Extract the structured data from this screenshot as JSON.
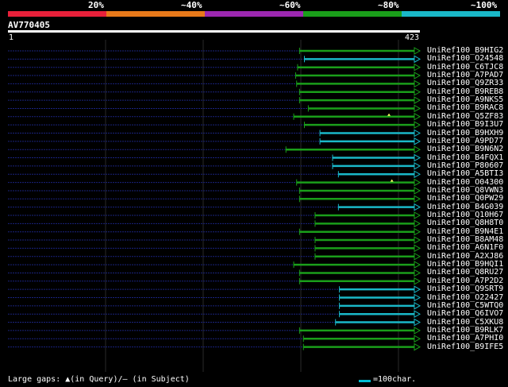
{
  "legend": {
    "segments": [
      {
        "label": "20%",
        "color": "#e8203a"
      },
      {
        "label": "~40%",
        "color": "#e8791a"
      },
      {
        "label": "~60%",
        "color": "#9c27b0"
      },
      {
        "label": "~80%",
        "color": "#1a9e1a"
      },
      {
        "label": "~100%",
        "color": "#1ab8c8"
      }
    ]
  },
  "query": {
    "name": "AV770405",
    "start": "1",
    "end": "423",
    "length": 423
  },
  "colors": {
    "green": "#1a9e1a",
    "cyan": "#1ab8c8",
    "dotted": "#1a237e",
    "grid": "#2a2a2a",
    "gap": "#ffff66"
  },
  "hits": [
    {
      "label": "UniRef100_B9HIG2",
      "start": 300,
      "color": "green",
      "gap": false
    },
    {
      "label": "UniRef100_O24548",
      "start": 305,
      "color": "cyan",
      "gap": false
    },
    {
      "label": "UniRef100_C6TJC8",
      "start": 298,
      "color": "green",
      "gap": false
    },
    {
      "label": "UniRef100_A7PAD7",
      "start": 296,
      "color": "green",
      "gap": false
    },
    {
      "label": "UniRef100_Q9ZR33",
      "start": 297,
      "color": "green",
      "gap": false
    },
    {
      "label": "UniRef100_B9REB8",
      "start": 300,
      "color": "green",
      "gap": false
    },
    {
      "label": "UniRef100_A9NKS5",
      "start": 300,
      "color": "green",
      "gap": false
    },
    {
      "label": "UniRef100_B9RAC8",
      "start": 309,
      "color": "green",
      "gap": false
    },
    {
      "label": "UniRef100_Q5ZF83",
      "start": 294,
      "color": "green",
      "gap": true,
      "gap_at": 392
    },
    {
      "label": "UniRef100_B9I3U7",
      "start": 305,
      "color": "green",
      "gap": false
    },
    {
      "label": "UniRef100_B9HXH9",
      "start": 321,
      "color": "cyan",
      "gap": false
    },
    {
      "label": "UniRef100_A9PD77",
      "start": 321,
      "color": "cyan",
      "gap": false
    },
    {
      "label": "UniRef100_B9N6N2",
      "start": 286,
      "color": "green",
      "gap": false
    },
    {
      "label": "UniRef100_B4FQX1",
      "start": 334,
      "color": "cyan",
      "gap": false
    },
    {
      "label": "UniRef100_P80607",
      "start": 334,
      "color": "cyan",
      "gap": false
    },
    {
      "label": "UniRef100_A5BTI3",
      "start": 340,
      "color": "cyan",
      "gap": false
    },
    {
      "label": "UniRef100_O04300",
      "start": 297,
      "color": "green",
      "gap": true,
      "gap_at": 395
    },
    {
      "label": "UniRef100_Q8VWN3",
      "start": 300,
      "color": "green",
      "gap": false
    },
    {
      "label": "UniRef100_Q0PW29",
      "start": 300,
      "color": "green",
      "gap": false
    },
    {
      "label": "UniRef100_B4G039",
      "start": 340,
      "color": "cyan",
      "gap": false
    },
    {
      "label": "UniRef100_Q10H67",
      "start": 316,
      "color": "green",
      "gap": false
    },
    {
      "label": "UniRef100_Q8H8T0",
      "start": 316,
      "color": "green",
      "gap": false
    },
    {
      "label": "UniRef100_B9N4E1",
      "start": 300,
      "color": "green",
      "gap": false
    },
    {
      "label": "UniRef100_B8AM48",
      "start": 316,
      "color": "green",
      "gap": false
    },
    {
      "label": "UniRef100_A6N1F0",
      "start": 316,
      "color": "green",
      "gap": false
    },
    {
      "label": "UniRef100_A2XJ86",
      "start": 316,
      "color": "green",
      "gap": false
    },
    {
      "label": "UniRef100_B9HQI1",
      "start": 294,
      "color": "green",
      "gap": false
    },
    {
      "label": "UniRef100_Q8RU27",
      "start": 300,
      "color": "green",
      "gap": false
    },
    {
      "label": "UniRef100_A7P2D2",
      "start": 300,
      "color": "green",
      "gap": false
    },
    {
      "label": "UniRef100_Q9SRT9",
      "start": 341,
      "color": "cyan",
      "gap": false
    },
    {
      "label": "UniRef100_O22427",
      "start": 341,
      "color": "cyan",
      "gap": false
    },
    {
      "label": "UniRef100_C5WTQ0",
      "start": 341,
      "color": "cyan",
      "gap": false
    },
    {
      "label": "UniRef100_Q6IVO7",
      "start": 341,
      "color": "cyan",
      "gap": false
    },
    {
      "label": "UniRef100_C5XKU8",
      "start": 337,
      "color": "cyan",
      "gap": false
    },
    {
      "label": "UniRef100_B9RLK7",
      "start": 300,
      "color": "green",
      "gap": false
    },
    {
      "label": "UniRef100_A7PHI0",
      "start": 304,
      "color": "green",
      "gap": false
    },
    {
      "label": "UniRef100_B9IFE5",
      "start": 304,
      "color": "green",
      "gap": false
    }
  ],
  "footer": {
    "gaps_text": "Large gaps: ▲(in Query)/— (in Subject)",
    "scale_text": "=100char."
  }
}
